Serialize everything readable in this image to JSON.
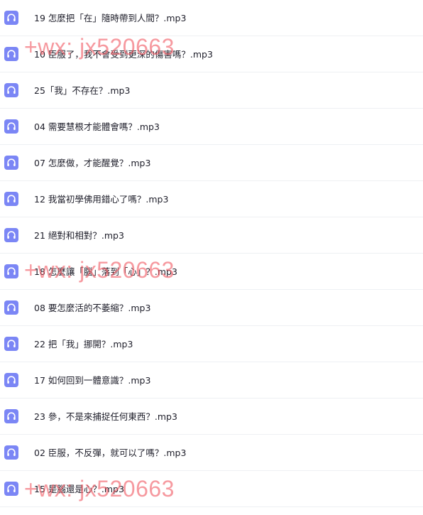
{
  "files": [
    {
      "name": "19 怎麼把「在」隨時帶到人間？.mp3"
    },
    {
      "name": "10 臣服了，我不會受到更深的傷害嗎？.mp3"
    },
    {
      "name": "25「我」不存在？.mp3"
    },
    {
      "name": "04 需要慧根才能體會嗎？.mp3"
    },
    {
      "name": "07 怎麼做，才能醒覺？.mp3"
    },
    {
      "name": "12 我當初學佛用錯心了嗎？.mp3"
    },
    {
      "name": "21 絕對和相對？.mp3"
    },
    {
      "name": "18 怎麼讓「腦」落到「心」？.mp3"
    },
    {
      "name": "08 要怎麼活的不萎縮？.mp3"
    },
    {
      "name": "22 把「我」挪開？.mp3"
    },
    {
      "name": "17 如何回到一體意識？.mp3"
    },
    {
      "name": "23 參，不是來捕捉任何東西？.mp3"
    },
    {
      "name": "02 臣服，不反彈，就可以了嗎？.mp3"
    },
    {
      "name": "15 是腦還是心？.mp3"
    }
  ],
  "watermark": "+wx: jx520663",
  "colors": {
    "icon_bg": "#7b86f5",
    "watermark": "#f05a64"
  },
  "icon": "headphones-icon"
}
